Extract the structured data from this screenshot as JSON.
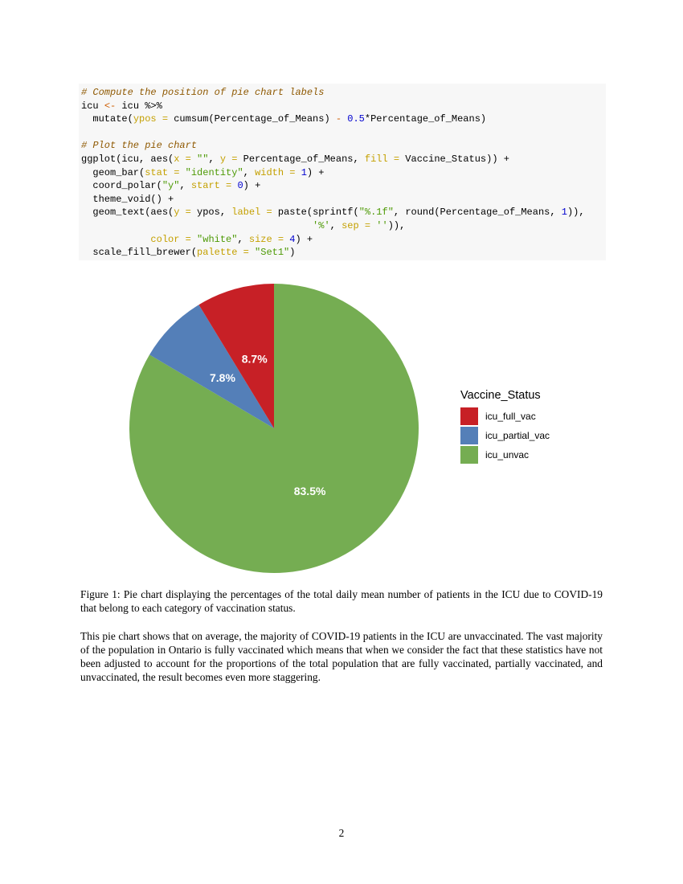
{
  "code": {
    "lines": [
      [
        {
          "t": "# Compute the position of pie chart labels",
          "c": "comment"
        }
      ],
      [
        {
          "t": "icu "
        },
        {
          "t": "<-",
          "c": "op"
        },
        {
          "t": " icu %>%"
        }
      ],
      [
        {
          "t": "  mutate("
        },
        {
          "t": "ypos =",
          "c": "arg"
        },
        {
          "t": " cumsum(Percentage_of_Means) "
        },
        {
          "t": "-",
          "c": "op"
        },
        {
          "t": " "
        },
        {
          "t": "0.5",
          "c": "num"
        },
        {
          "t": "*Percentage_of_Means)"
        }
      ],
      [],
      [
        {
          "t": "# Plot the pie chart",
          "c": "comment"
        }
      ],
      [
        {
          "t": "ggplot(icu, aes("
        },
        {
          "t": "x =",
          "c": "arg"
        },
        {
          "t": " "
        },
        {
          "t": "\"\"",
          "c": "str"
        },
        {
          "t": ", "
        },
        {
          "t": "y =",
          "c": "arg"
        },
        {
          "t": " Percentage_of_Means, "
        },
        {
          "t": "fill =",
          "c": "arg"
        },
        {
          "t": " Vaccine_Status)) +"
        }
      ],
      [
        {
          "t": "  geom_bar("
        },
        {
          "t": "stat =",
          "c": "arg"
        },
        {
          "t": " "
        },
        {
          "t": "\"identity\"",
          "c": "str"
        },
        {
          "t": ", "
        },
        {
          "t": "width =",
          "c": "arg"
        },
        {
          "t": " "
        },
        {
          "t": "1",
          "c": "num"
        },
        {
          "t": ") +"
        }
      ],
      [
        {
          "t": "  coord_polar("
        },
        {
          "t": "\"y\"",
          "c": "str"
        },
        {
          "t": ", "
        },
        {
          "t": "start =",
          "c": "arg"
        },
        {
          "t": " "
        },
        {
          "t": "0",
          "c": "num"
        },
        {
          "t": ") +"
        }
      ],
      [
        {
          "t": "  theme_void() +"
        }
      ],
      [
        {
          "t": "  geom_text(aes("
        },
        {
          "t": "y =",
          "c": "arg"
        },
        {
          "t": " ypos, "
        },
        {
          "t": "label =",
          "c": "arg"
        },
        {
          "t": " paste(sprintf("
        },
        {
          "t": "\"%.1f\"",
          "c": "str"
        },
        {
          "t": ", round(Percentage_of_Means, "
        },
        {
          "t": "1",
          "c": "num"
        },
        {
          "t": ")),"
        }
      ],
      [
        {
          "t": "                                        "
        },
        {
          "t": "'%'",
          "c": "str"
        },
        {
          "t": ", "
        },
        {
          "t": "sep =",
          "c": "arg"
        },
        {
          "t": " "
        },
        {
          "t": "''",
          "c": "str"
        },
        {
          "t": ")),"
        }
      ],
      [
        {
          "t": "            "
        },
        {
          "t": "color =",
          "c": "arg"
        },
        {
          "t": " "
        },
        {
          "t": "\"white\"",
          "c": "str"
        },
        {
          "t": ", "
        },
        {
          "t": "size =",
          "c": "arg"
        },
        {
          "t": " "
        },
        {
          "t": "4",
          "c": "num"
        },
        {
          "t": ") +"
        }
      ],
      [
        {
          "t": "  scale_fill_brewer("
        },
        {
          "t": "palette =",
          "c": "arg"
        },
        {
          "t": " "
        },
        {
          "t": "\"Set1\"",
          "c": "str"
        },
        {
          "t": ")"
        }
      ]
    ]
  },
  "chart_data": {
    "type": "pie",
    "legend_title": "Vaccine_Status",
    "legend_position": "right",
    "slices": [
      {
        "name": "icu_full_vac",
        "value": 8.7,
        "label": "8.7%",
        "color": "#c72026"
      },
      {
        "name": "icu_partial_vac",
        "value": 7.8,
        "label": "7.8%",
        "color": "#547fb8"
      },
      {
        "name": "icu_unvac",
        "value": 83.5,
        "label": "83.5%",
        "color": "#75ad52"
      }
    ]
  },
  "caption": "Figure 1: Pie chart displaying the percentages of the total daily mean number of patients in the ICU due to COVID-19 that belong to each category of vaccination status.",
  "paragraph": "This pie chart shows that on average, the majority of COVID-19 patients in the ICU are unvaccinated. The vast majority of the population in Ontario is fully vaccinated which means that when we consider the fact that these statistics have not been adjusted to account for the proportions of the total population that are fully vaccinated, partially vaccinated, and unvaccinated, the result becomes even more staggering.",
  "page_number": "2"
}
